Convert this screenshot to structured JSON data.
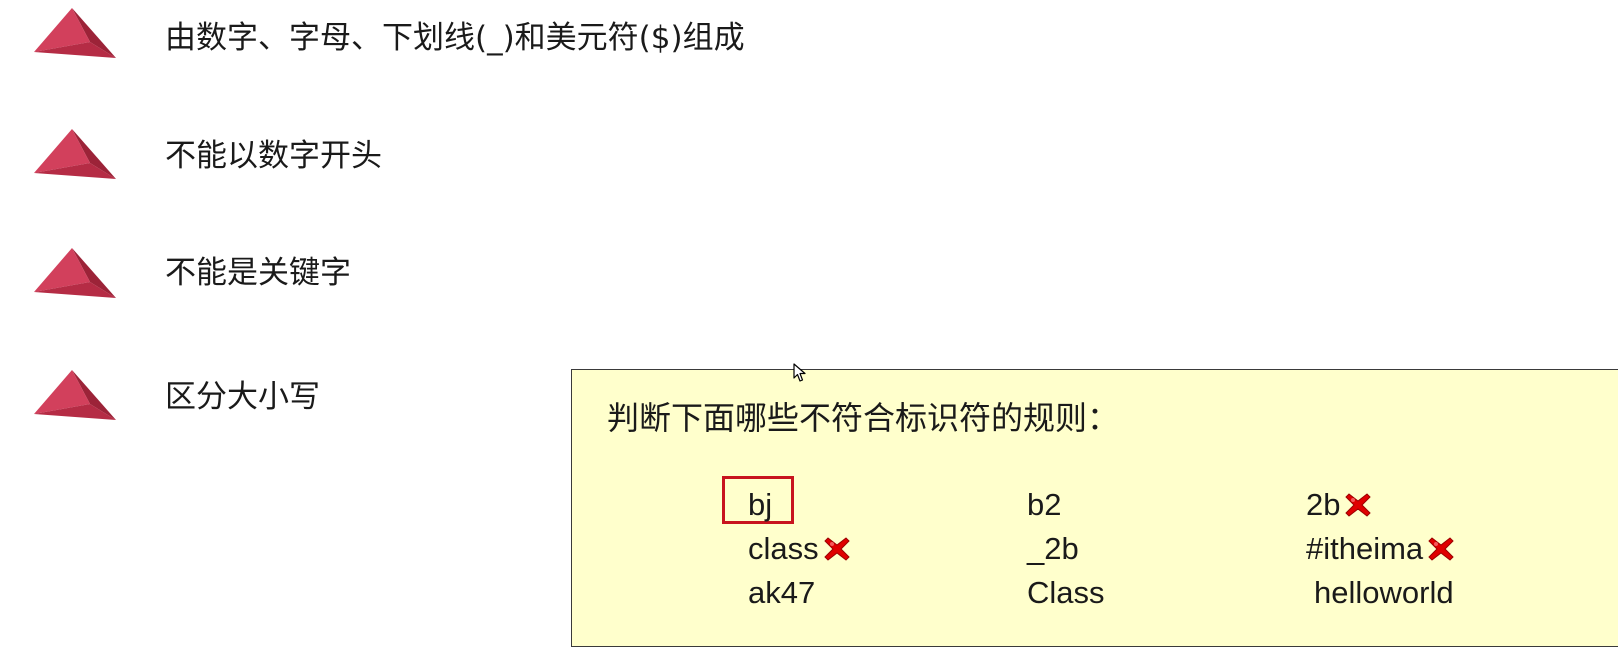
{
  "rules": [
    {
      "text": "由数字、字母、下划线(_)和美元符($)组成"
    },
    {
      "text": "不能以数字开头"
    },
    {
      "text": "不能是关键字"
    },
    {
      "text": "区分大小写"
    }
  ],
  "question": {
    "title": "判断下面哪些不符合标识符的规则：",
    "items": [
      {
        "text": "bj",
        "invalid": false,
        "highlighted": true
      },
      {
        "text": "b2",
        "invalid": false
      },
      {
        "text": "2b",
        "invalid": true
      },
      {
        "text": "class",
        "invalid": true
      },
      {
        "text": "_2b",
        "invalid": false
      },
      {
        "text": "#itheima",
        "invalid": true
      },
      {
        "text": "ak47",
        "invalid": false
      },
      {
        "text": "Class",
        "invalid": false
      },
      {
        "text": "helloworld",
        "invalid": false
      }
    ]
  },
  "colors": {
    "bullet": "#c8364f",
    "panel_background": "#ffffcc",
    "highlight": "#c8141e",
    "cross": "#e00000"
  },
  "icons": {
    "bullet": "triangle-bullet-icon",
    "invalid_mark": "red-cross-icon",
    "pointer": "mouse-cursor-icon"
  }
}
